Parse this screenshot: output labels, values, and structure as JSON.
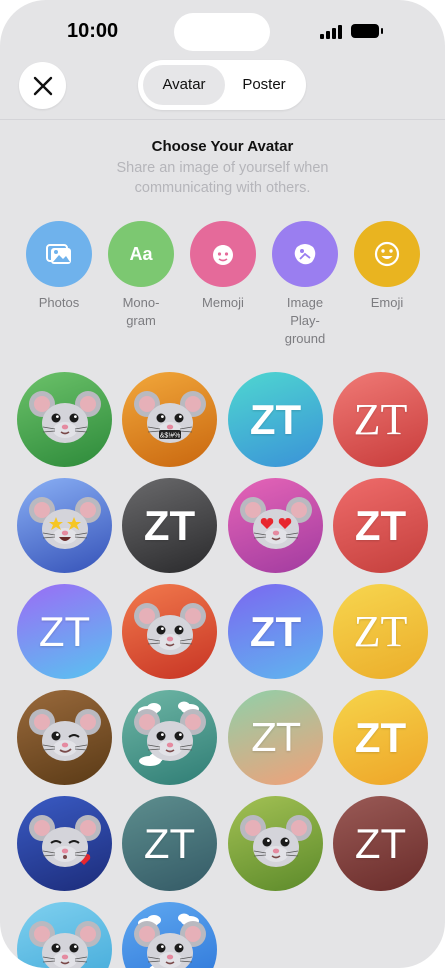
{
  "status": {
    "time": "10:00"
  },
  "header": {
    "segments": [
      "Avatar",
      "Poster"
    ],
    "selected_segment": "Avatar"
  },
  "intro": {
    "title": "Choose Your Avatar",
    "subtitle": "Share an image of yourself when communicating with others."
  },
  "sources": [
    {
      "label": "Photos",
      "icon": "photos-icon",
      "color": "#6fb2ec"
    },
    {
      "label": "Mono-\ngram",
      "icon": "monogram-icon",
      "color": "#7cc871"
    },
    {
      "label": "Memoji",
      "icon": "memoji-icon",
      "color": "#e56a9a"
    },
    {
      "label": "Image\nPlay-\nground",
      "icon": "image-playground-icon",
      "color": "#9a7ef0"
    },
    {
      "label": "Emoji",
      "icon": "emoji-icon",
      "color": "#e9b420"
    }
  ],
  "monogram_text": "ZT",
  "memoji_symbols_text": "&$!#%",
  "avatars": [
    {
      "kind": "memoji",
      "variant": "plain",
      "bg": [
        "#6cc26a",
        "#2d8a3a"
      ]
    },
    {
      "kind": "memoji",
      "variant": "symbols",
      "bg": [
        "#f2a83b",
        "#c9670f"
      ]
    },
    {
      "kind": "monogram",
      "style": "bold",
      "bg": [
        "#4fd7d0",
        "#3a92d8"
      ]
    },
    {
      "kind": "monogram",
      "style": "serif",
      "bg": [
        "#f07a76",
        "#c83c3b"
      ]
    },
    {
      "kind": "memoji",
      "variant": "star-eyes",
      "bg": [
        "#8ab0f5",
        "#3552b8"
      ]
    },
    {
      "kind": "monogram",
      "style": "bold",
      "bg": [
        "#6a6a6c",
        "#2a2a2c"
      ]
    },
    {
      "kind": "memoji",
      "variant": "heart-eyes",
      "bg": [
        "#e665b7",
        "#a13ba0"
      ]
    },
    {
      "kind": "monogram",
      "style": "bold",
      "bg": [
        "#ef6c6b",
        "#c43f3c"
      ]
    },
    {
      "kind": "monogram",
      "style": "light",
      "bg": [
        "#9b6cf5",
        "#58c3f0"
      ]
    },
    {
      "kind": "memoji",
      "variant": "plain",
      "bg": [
        "#f27a4d",
        "#c73424"
      ]
    },
    {
      "kind": "monogram",
      "style": "bold",
      "bg": [
        "#7b67f0",
        "#5fb6ef"
      ]
    },
    {
      "kind": "monogram",
      "style": "serif",
      "bg": [
        "#f7d64f",
        "#ebad2a"
      ]
    },
    {
      "kind": "memoji",
      "variant": "wink",
      "bg": [
        "#9a6a3c",
        "#5a3a16"
      ]
    },
    {
      "kind": "memoji",
      "variant": "clouds",
      "bg": [
        "#6fb7a6",
        "#2f7d75"
      ]
    },
    {
      "kind": "monogram",
      "style": "sans-thin",
      "bg": [
        "#8fd0a9",
        "#f1a079"
      ]
    },
    {
      "kind": "monogram",
      "style": "bold",
      "bg": [
        "#f6d44a",
        "#eea528"
      ]
    },
    {
      "kind": "memoji",
      "variant": "kiss",
      "bg": [
        "#3a5bc4",
        "#1c2c7a"
      ]
    },
    {
      "kind": "monogram",
      "style": "light",
      "bg": [
        "#5d8e8e",
        "#345a66"
      ]
    },
    {
      "kind": "memoji",
      "variant": "plain",
      "bg": [
        "#a3c154",
        "#5c8a2a"
      ]
    },
    {
      "kind": "monogram",
      "style": "light",
      "bg": [
        "#9a5a56",
        "#6a2c2a"
      ]
    },
    {
      "kind": "memoji",
      "variant": "plain",
      "bg": [
        "#7fd0ef",
        "#3ea7d8"
      ]
    },
    {
      "kind": "memoji",
      "variant": "clouds",
      "bg": [
        "#5fa8f0",
        "#2a73d8"
      ]
    }
  ]
}
